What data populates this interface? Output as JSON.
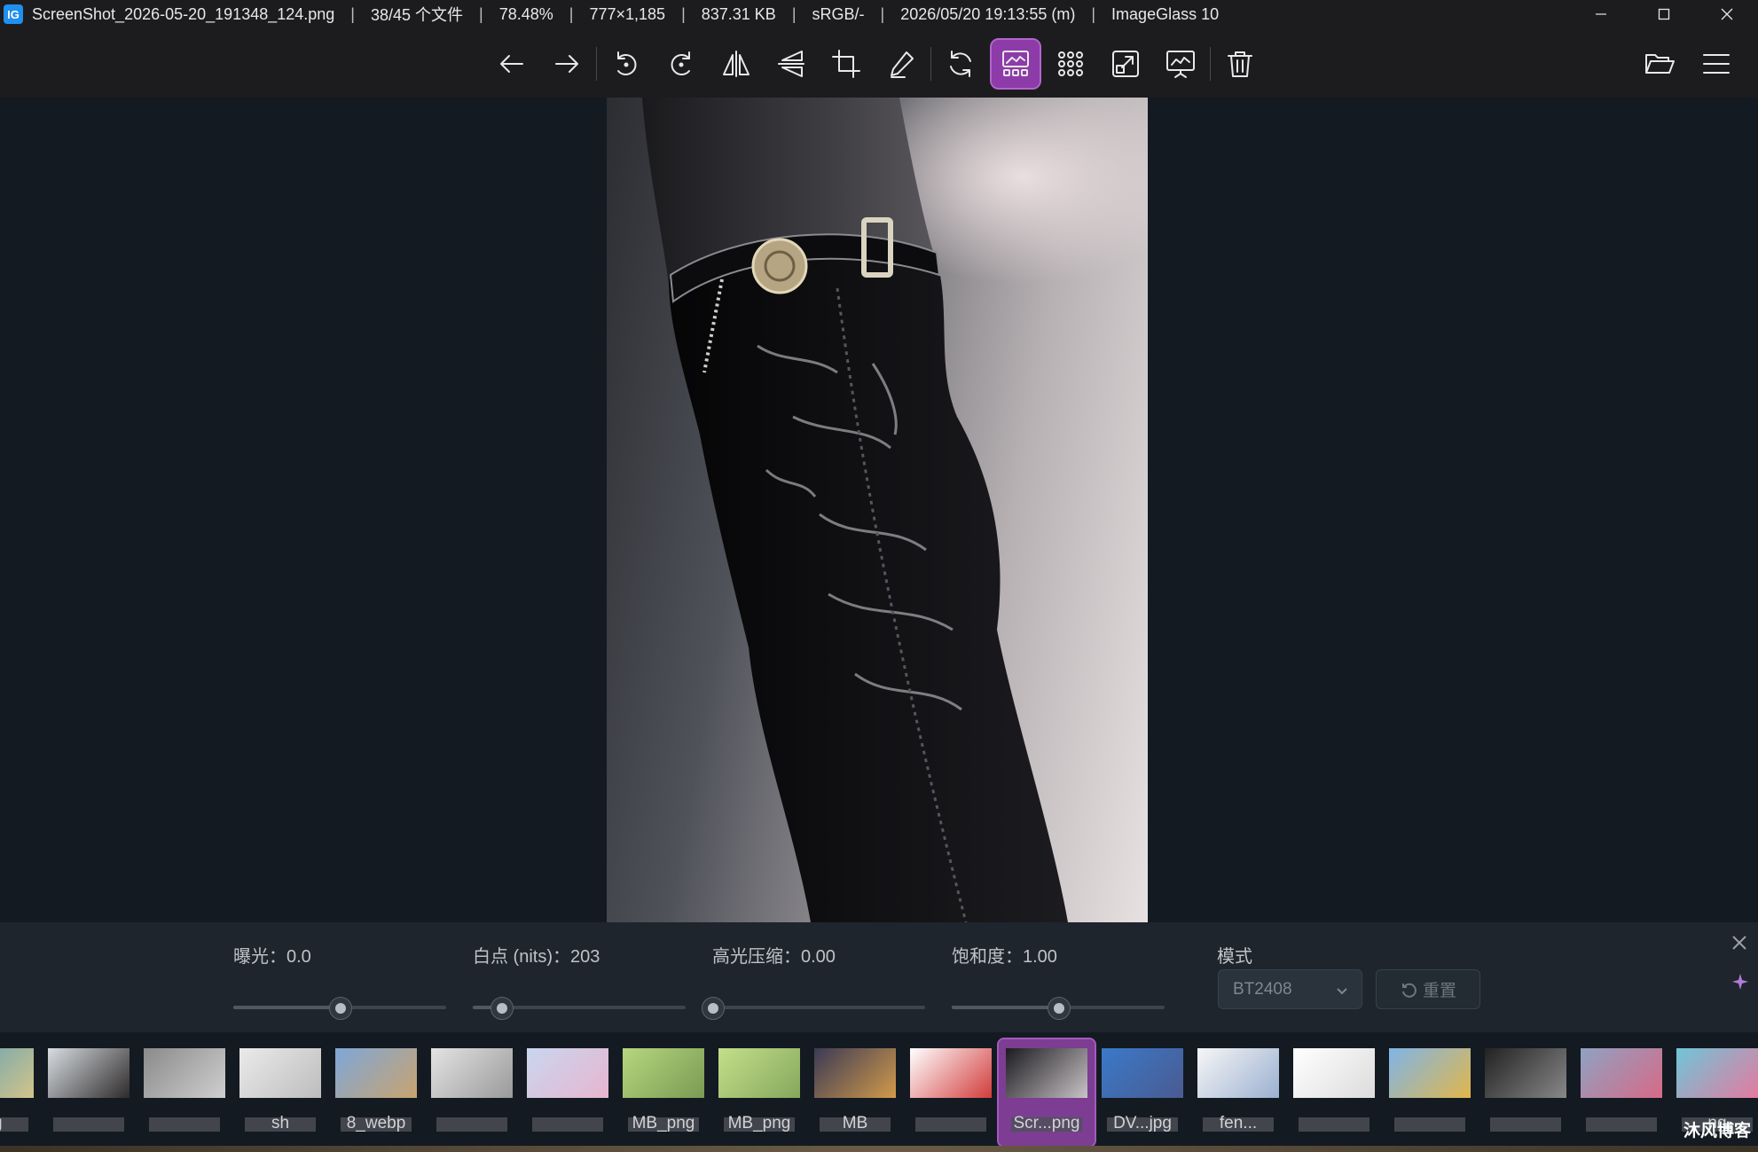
{
  "window": {
    "app_icon_text": "IG",
    "title_parts": [
      "ScreenShot_2026-05-20_191348_124.png",
      "38/45 个文件",
      "78.48%",
      "777×1,185",
      "837.31 KB",
      "sRGB/-",
      "2026/05/20 19:13:55 (m)",
      "ImageGlass 10"
    ],
    "separator": "|"
  },
  "toolbar": {
    "tools": [
      {
        "name": "previous-image",
        "icon": "arrow-left-icon",
        "active": false
      },
      {
        "name": "next-image",
        "icon": "arrow-right-icon",
        "active": false
      },
      {
        "name": "rotate-left",
        "icon": "rotate-ccw-icon",
        "active": false
      },
      {
        "name": "rotate-right",
        "icon": "rotate-cw-icon",
        "active": false
      },
      {
        "name": "flip-horizontal",
        "icon": "flip-horizontal-icon",
        "active": false
      },
      {
        "name": "flip-vertical",
        "icon": "flip-vertical-icon",
        "active": false
      },
      {
        "name": "crop",
        "icon": "crop-icon",
        "active": false
      },
      {
        "name": "color-picker",
        "icon": "eyedropper-icon",
        "active": false
      },
      {
        "name": "refresh",
        "icon": "refresh-icon",
        "active": false
      },
      {
        "name": "hdr-adjust",
        "icon": "image-gallery-icon",
        "active": true
      },
      {
        "name": "thumbnail-grid",
        "icon": "grid-icon",
        "active": false
      },
      {
        "name": "open-external",
        "icon": "external-window-icon",
        "active": false
      },
      {
        "name": "slideshow",
        "icon": "slideshow-icon",
        "active": false
      },
      {
        "name": "delete",
        "icon": "trash-icon",
        "active": false
      }
    ],
    "right_tools": [
      {
        "name": "open-folder",
        "icon": "folder-open-icon"
      },
      {
        "name": "main-menu",
        "icon": "hamburger-menu-icon"
      }
    ]
  },
  "adjust_panel": {
    "sliders": [
      {
        "label": "曝光：0.0",
        "value": 0.0,
        "min": -5,
        "max": 5
      },
      {
        "label": "白点 (nits)：203",
        "value": 203,
        "min": 80,
        "max": 1000
      },
      {
        "label": "高光压缩：0.00",
        "value": 0.0,
        "min": 0,
        "max": 1
      },
      {
        "label": "饱和度：1.00",
        "value": 1.0,
        "min": 0,
        "max": 2
      }
    ],
    "mode_label": "模式",
    "mode_value": "BT2408",
    "reset_label": "重置"
  },
  "thumbnails": [
    {
      "label": "ng",
      "colors": [
        "#5aa0b8",
        "#d3c48a"
      ],
      "active": false
    },
    {
      "label": "",
      "colors": [
        "#d8dde2",
        "#2e2a2a"
      ],
      "active": false
    },
    {
      "label": "",
      "colors": [
        "#8a8a8a",
        "#cfcfcf"
      ],
      "active": false
    },
    {
      "label": "sh",
      "colors": [
        "#eaeaea",
        "#bdbdbd"
      ],
      "active": false
    },
    {
      "label": "8_webp",
      "colors": [
        "#7ea7d8",
        "#c9a36f"
      ],
      "active": false
    },
    {
      "label": "",
      "colors": [
        "#e3e3e3",
        "#9a9a9a"
      ],
      "active": false
    },
    {
      "label": "",
      "colors": [
        "#c9d6ef",
        "#e7b5cf"
      ],
      "active": false
    },
    {
      "label": "MB_png",
      "colors": [
        "#b6d67f",
        "#7a9b53"
      ],
      "active": false
    },
    {
      "label": "MB_png",
      "colors": [
        "#c3df8b",
        "#86a75c"
      ],
      "active": false
    },
    {
      "label": "MB",
      "colors": [
        "#3b3a55",
        "#d29a4a"
      ],
      "active": false
    },
    {
      "label": "",
      "colors": [
        "#ffffff",
        "#d23c3c"
      ],
      "active": false
    },
    {
      "label": "Scr...png",
      "colors": [
        "#1b1b1f",
        "#c9c3c6"
      ],
      "active": true
    },
    {
      "label": "DV...jpg",
      "colors": [
        "#3a79c9",
        "#4a5b91"
      ],
      "active": false
    },
    {
      "label": "fen...",
      "colors": [
        "#f6f6f6",
        "#9bb0d0"
      ],
      "active": false
    },
    {
      "label": "",
      "colors": [
        "#ffffff",
        "#dcdcdc"
      ],
      "active": false
    },
    {
      "label": "",
      "colors": [
        "#7fb5e8",
        "#e1b64a"
      ],
      "active": false
    },
    {
      "label": "",
      "colors": [
        "#222",
        "#888"
      ],
      "active": false
    },
    {
      "label": "",
      "colors": [
        "#8fa2c2",
        "#d66a88"
      ],
      "active": false
    },
    {
      "label": "ng",
      "colors": [
        "#6ec6d8",
        "#e47aa0"
      ],
      "active": false
    }
  ],
  "watermark": "沐风博客",
  "colors": {
    "accent": "#8d3ba8",
    "background": "#141a21",
    "panel": "#1e252d"
  }
}
